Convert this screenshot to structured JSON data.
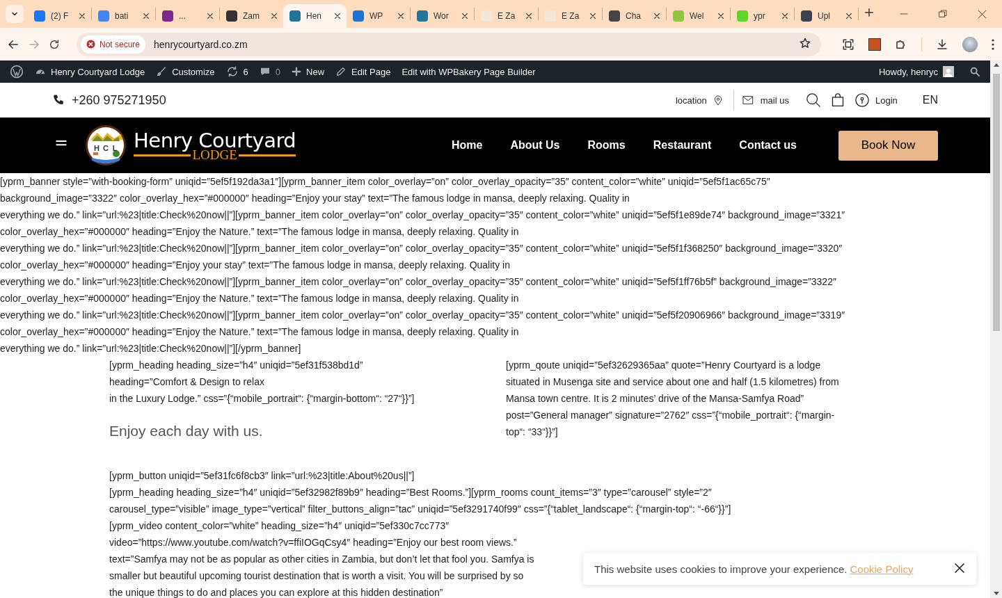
{
  "browser": {
    "tabs": [
      {
        "title": "(2) F",
        "color": "#1877f2",
        "selected": false
      },
      {
        "title": "bati",
        "color": "#4285f4",
        "selected": false
      },
      {
        "title": "...",
        "color": "#7b2b8c",
        "selected": false
      },
      {
        "title": "Zam",
        "color": "#333333",
        "selected": false
      },
      {
        "title": "Hen",
        "color": "#21759b",
        "selected": true
      },
      {
        "title": "WP",
        "color": "#1e6fd9",
        "selected": false
      },
      {
        "title": "Wor",
        "color": "#21759b",
        "selected": false
      },
      {
        "title": "E Za",
        "color": "#f3e6da",
        "selected": false
      },
      {
        "title": "E Za",
        "color": "#f3e6da",
        "selected": false
      },
      {
        "title": "Cha",
        "color": "#444444",
        "selected": false
      },
      {
        "title": "Wel",
        "color": "#8dc63f",
        "selected": false
      },
      {
        "title": "ypr",
        "color": "#5ed62a",
        "selected": false
      },
      {
        "title": "Upl",
        "color": "#3b4252",
        "selected": false
      }
    ],
    "address": {
      "security": "Not secure",
      "url": "henrycourtyard.co.zm"
    }
  },
  "admin_bar": {
    "items": [
      {
        "kind": "site",
        "label": "Henry Courtyard Lodge"
      },
      {
        "kind": "customize",
        "label": "Customize"
      },
      {
        "kind": "updates",
        "label": "6"
      },
      {
        "kind": "comments",
        "label": "0"
      },
      {
        "kind": "new",
        "label": "New"
      },
      {
        "kind": "edit",
        "label": "Edit Page"
      },
      {
        "kind": "builder",
        "label": "Edit with WPBakery Page Builder"
      }
    ],
    "greeting": "Howdy, henryc"
  },
  "top_bar": {
    "phone": "+260 975271950",
    "location": "location",
    "mail": "mail us",
    "login": "Login",
    "language": "EN"
  },
  "nav": {
    "logo": {
      "letters": [
        "H",
        "C",
        "L"
      ],
      "title": "Henry Courtyard",
      "subtitle": "LODGE"
    },
    "items": [
      "Home",
      "About Us",
      "Rooms",
      "Restaurant",
      "Contact us"
    ],
    "cta": "Book Now"
  },
  "content": {
    "banner_lines": [
      "[yprm_banner style=”with-booking-form” uniqid=”5ef5f192da3a1″][yprm_banner_item color_overlay=”on” color_overlay_opacity=”35″ content_color=”white” uniqid=”5ef5f1ac65c75″",
      "background_image=”3322″ color_overlay_hex=”#000000″ heading=”Enjoy your stay” text=”The famous lodge in mansa, deeply relaxing. Quality in",
      "everything we do.” link=”url:%23|title:Check%20now||”][yprm_banner_item color_overlay=”on” color_overlay_opacity=”35″ content_color=”white” uniqid=”5ef5f1e89de74″ background_image=”3321″",
      "color_overlay_hex=”#000000″ heading=”Enjoy the Nature.” text=”The famous lodge in mansa, deeply relaxing. Quality in",
      "everything we do.” link=”url:%23|title:Check%20now||”][yprm_banner_item color_overlay=”on” color_overlay_opacity=”35″ content_color=”white” uniqid=”5ef5f1f368250″ background_image=”3320″",
      "color_overlay_hex=”#000000″ heading=”Enjoy your stay” text=”The famous lodge in mansa, deeply relaxing. Quality in",
      "everything we do.” link=”url:%23|title:Check%20now||”][yprm_banner_item color_overlay=”on” color_overlay_opacity=”35″ content_color=”white” uniqid=”5ef5f1ff76b5f” background_image=”3322″",
      "color_overlay_hex=”#000000″ heading=”Enjoy the Nature.” text=”The famous lodge in mansa, deeply relaxing. Quality in",
      "everything we do.” link=”url:%23|title:Check%20now||”][yprm_banner_item color_overlay=”on” color_overlay_opacity=”35″ content_color=”white” uniqid=”5ef5f20906966″ background_image=”3319″",
      "color_overlay_hex=”#000000″ heading=”Enjoy the Nature.” text=”The famous lodge in mansa, deeply relaxing. Quality in",
      "everything we do.” link=”url:%23|title:Check%20now||”][/yprm_banner]"
    ],
    "left_lines": [
      "[yprm_heading heading_size=”h4″ uniqid=”5ef31f538bd1d”",
      "heading=”Comfort & Design to relax",
      "in the Luxury Lodge.” css=”{“mobile_portrait“: {“margin-bottom“: “27“}}”]"
    ],
    "heading": "Enjoy each day with us.",
    "right_lines": [
      "[yprm_qoute uniqid=”5ef32629365aa” quote=”Henry Courtyard is a lodge",
      "situated in Musenga site and service about one and half (1.5 kilometres) from",
      "Mansa town centre. It is 2 minutes’ drive of the Mansa-Samfya Road”",
      "post=”General manager” signature=”2762″ css=”{“mobile_portrait“: {“margin-",
      "top“: “33“}}”]"
    ],
    "lines": [
      "[yprm_button uniqid=”5ef31fc6f8cb3″ link=”url:%23|title:About%20us||”]",
      "[yprm_heading heading_size=”h4″ uniqid=”5ef32982f89b9″ heading=”Best Rooms.”][yprm_rooms count_items=”3″ type=”carousel” style=”2″",
      "carousel_type=”visible” image_type=”vertical” filter_buttons_align=”tac” uniqid=”5ef3291740f99″ css=”{“tablet_landscape“: {“margin-top“: “-66“}}”]",
      "[yprm_video content_color=”white” heading_size=”h4″ uniqid=”5ef330c7cc773″",
      "video=”https://www.youtube.com/watch?v=ffiIOGqCsy4″ heading=”Enjoy our best room views.”",
      "text=”Samfya may not be as popular as other cities in Zambia, but don’t let that fool you. Samfya is",
      "smaller but beautiful upcoming tourist destination that is worth a visit. You will be surprised by so",
      "the unique things to do and places you can explore at this hidden destination”"
    ]
  },
  "cookie_notice": {
    "text": "This website uses cookies to improve your experience.",
    "link": "Cookie Policy"
  }
}
